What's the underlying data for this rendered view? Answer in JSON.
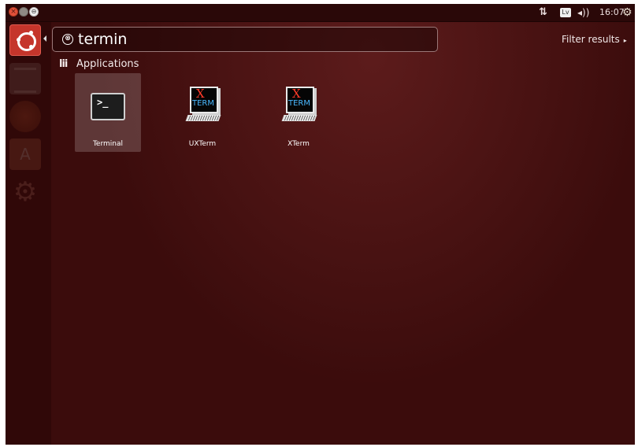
{
  "window_controls": {
    "close_glyph": "×",
    "maximize_glyph": "⊖"
  },
  "panel": {
    "keyboard_layout": "Lv",
    "sound_glyph": "◂))",
    "clock": "16:07",
    "network_glyph": "⇅",
    "settings_glyph": "⚙"
  },
  "launcher": {
    "items": [
      {
        "name": "dash-home",
        "icon": "ubuntu-logo-icon"
      },
      {
        "name": "files",
        "icon": "file-cabinet-icon"
      },
      {
        "name": "firefox",
        "icon": "firefox-icon"
      },
      {
        "name": "software-center",
        "icon": "shopping-bag-icon",
        "glyph": "A"
      },
      {
        "name": "system-settings",
        "icon": "gears-icon",
        "glyph": "⚙"
      }
    ]
  },
  "search": {
    "query": "termin",
    "clear_glyph": "⊗"
  },
  "filter": {
    "label": "Filter results",
    "arrow": "▸"
  },
  "category": {
    "icon_glyph": "lii",
    "label": "Applications"
  },
  "results": [
    {
      "label": "Terminal",
      "icon": "terminal-icon",
      "prompt": ">_",
      "selected": true
    },
    {
      "label": "UXTerm",
      "icon": "xterm-icon",
      "logo_x": "X",
      "logo_term": "TERM"
    },
    {
      "label": "XTerm",
      "icon": "xterm-icon",
      "logo_x": "X",
      "logo_term": "TERM"
    }
  ],
  "colors": {
    "dash_background": "#3b0c0c",
    "panel": "#2a0808",
    "bfb_accent": "#c5352b"
  }
}
